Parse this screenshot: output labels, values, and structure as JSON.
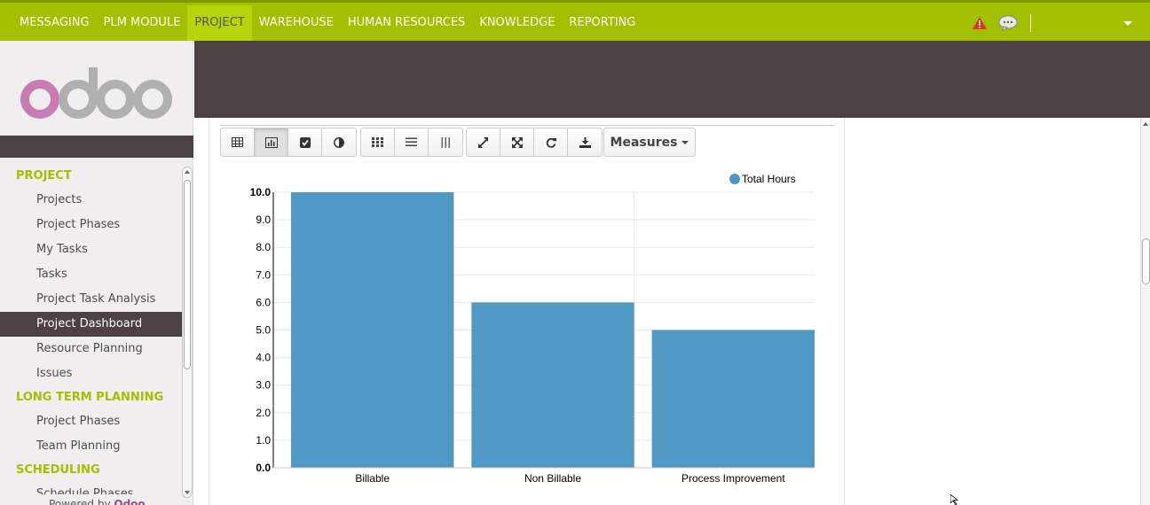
{
  "topbar": {
    "menu": [
      {
        "label": "MESSAGING",
        "active": false
      },
      {
        "label": "PLM MODULE",
        "active": false
      },
      {
        "label": "PROJECT",
        "active": true
      },
      {
        "label": "WAREHOUSE",
        "active": false
      },
      {
        "label": "HUMAN RESOURCES",
        "active": false
      },
      {
        "label": "KNOWLEDGE",
        "active": false
      },
      {
        "label": "REPORTING",
        "active": false
      }
    ]
  },
  "sidebar": {
    "logo_text": "odoo",
    "sections": [
      {
        "title": "PROJECT",
        "items": [
          "Projects",
          "Project Phases",
          "My Tasks",
          "Tasks",
          "Project Task Analysis",
          "Project Dashboard",
          "Resource Planning",
          "Issues"
        ]
      },
      {
        "title": "LONG TERM PLANNING",
        "items": [
          "Project Phases",
          "Team Planning"
        ]
      },
      {
        "title": "SCHEDULING",
        "items": [
          "Schedule Phases"
        ]
      }
    ],
    "active_item": "Project Dashboard",
    "powered_by": "Powered by",
    "powered_brand": "Odoo"
  },
  "toolbar": {
    "measures_label": "Measures"
  },
  "chart_data": {
    "type": "bar",
    "categories": [
      "Billable",
      "Non Billable",
      "Process Improvement"
    ],
    "series": [
      {
        "name": "Total Hours",
        "values": [
          10.0,
          6.0,
          5.0
        ],
        "color": "#4f98c3"
      }
    ],
    "ylim": [
      0,
      10
    ],
    "yticks": [
      "0.0",
      "1.0",
      "2.0",
      "3.0",
      "4.0",
      "5.0",
      "6.0",
      "7.0",
      "8.0",
      "9.0",
      "10.0"
    ],
    "grid": true,
    "legend": "top-right"
  },
  "colors": {
    "topbar": "#a2c000",
    "accent": "#a2c000",
    "dark": "#4c4243",
    "bar": "#4f98c3"
  }
}
